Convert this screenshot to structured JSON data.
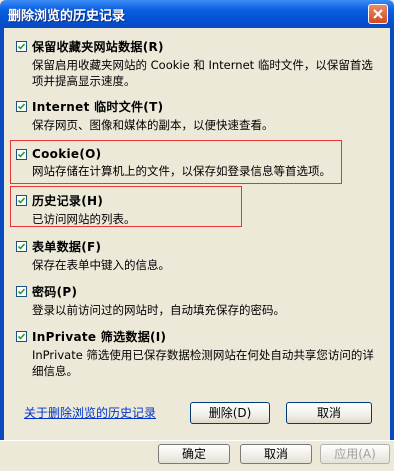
{
  "window": {
    "title": "删除浏览的历史记录"
  },
  "items": [
    {
      "label": "保留收藏夹网站数据(R)",
      "desc": "保留启用收藏夹网站的 Cookie 和 Internet 临时文件，以保留首选项并提高显示速度。",
      "checked": true
    },
    {
      "label": "Internet 临时文件(T)",
      "desc": "保存网页、图像和媒体的副本，以便快速查看。",
      "checked": true
    },
    {
      "label": "Cookie(O)",
      "desc": "网站存储在计算机上的文件，以保存如登录信息等首选项。",
      "checked": true
    },
    {
      "label": "历史记录(H)",
      "desc": "已访问网站的列表。",
      "checked": true
    },
    {
      "label": "表单数据(F)",
      "desc": "保存在表单中键入的信息。",
      "checked": true
    },
    {
      "label": "密码(P)",
      "desc": "登录以前访问过的网站时，自动填充保存的密码。",
      "checked": true
    },
    {
      "label": "InPrivate 筛选数据(I)",
      "desc": "InPrivate 筛选使用已保存数据检测网站在何处自动共享您访问的详细信息。",
      "checked": true
    }
  ],
  "footer": {
    "link": "关于删除浏览的历史记录",
    "delete_label": "删除(D)",
    "cancel_label": "取消"
  },
  "underlying": {
    "ok_label": "确定",
    "cancel_label": "取消",
    "apply_label": "应用(A)"
  },
  "colors": {
    "highlight": "#e33333",
    "titlebar": "#0a5fe0"
  }
}
